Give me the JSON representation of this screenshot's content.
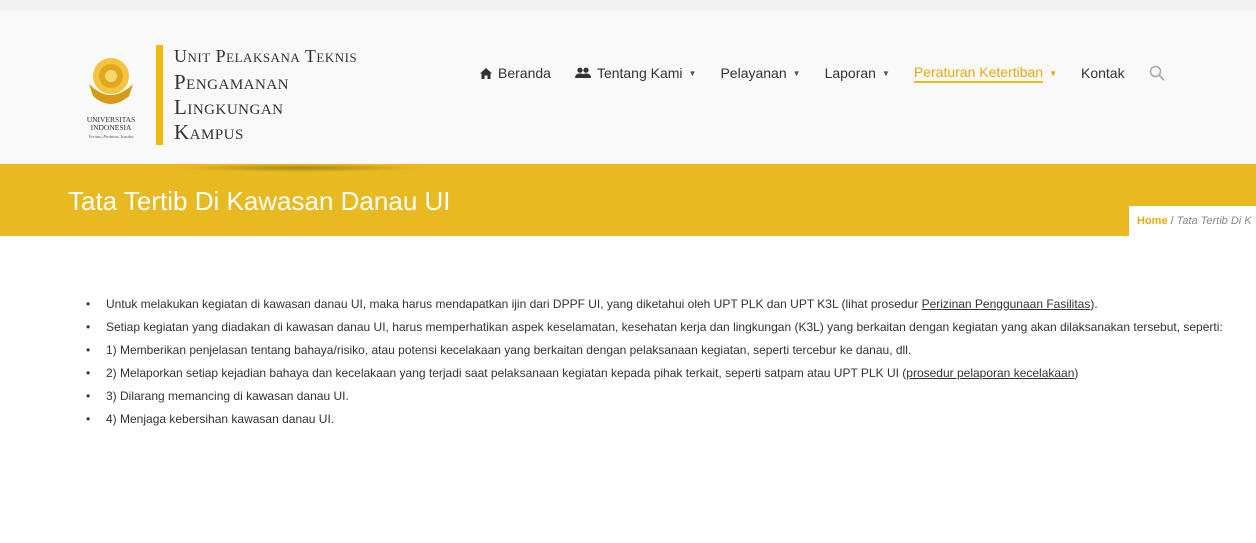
{
  "brand": {
    "lines": [
      "Unit Pelaksana Teknis",
      "Pengamanan",
      "Lingkungan",
      "Kampus"
    ],
    "logo_text": [
      "UNIVERSITAS",
      "INDONESIA",
      "Veritas, Probitas, Iustitia"
    ]
  },
  "nav": {
    "items": [
      {
        "label": "Beranda",
        "icon": "home-icon",
        "dropdown": false
      },
      {
        "label": "Tentang Kami",
        "icon": "users-icon",
        "dropdown": true
      },
      {
        "label": "Pelayanan",
        "dropdown": true
      },
      {
        "label": "Laporan",
        "dropdown": true
      },
      {
        "label": "Peraturan Ketertiban",
        "dropdown": true,
        "active": true
      },
      {
        "label": "Kontak",
        "dropdown": false
      }
    ],
    "search_icon": "search-icon"
  },
  "page": {
    "title": "Tata Tertib Di Kawasan Danau UI",
    "breadcrumb": {
      "home": "Home",
      "separator": "/",
      "current": "Tata Tertib Di K"
    }
  },
  "content": {
    "item1": {
      "text": "Untuk melakukan kegiatan di kawasan danau UI, maka harus mendapatkan ijin dari DPPF UI, yang diketahui oleh UPT PLK dan UPT K3L (lihat prosedur ",
      "link": "Perizinan Penggunaan Fasilitas",
      "after": ")."
    },
    "item2": "Setiap kegiatan yang diadakan di kawasan danau UI, harus memperhatikan aspek keselamatan, kesehatan kerja dan lingkungan (K3L) yang berkaitan dengan kegiatan yang akan dilaksanakan tersebut, seperti:",
    "item3": "1) Memberikan penjelasan tentang bahaya/risiko, atau potensi kecelakaan yang berkaitan dengan pelaksanaan kegiatan, seperti tercebur ke danau, dll.",
    "item4": {
      "text": "2) Melaporkan setiap kejadian bahaya dan kecelakaan yang terjadi saat pelaksanaan kegiatan kepada pihak terkait, seperti satpam atau UPT PLK UI (",
      "link": "prosedur pelaporan kecelakaan",
      "after": ")"
    },
    "item5": "3) Dilarang memancing di kawasan danau UI.",
    "item6": "4) Menjaga kebersihan kawasan danau UI."
  },
  "colors": {
    "accent": "#e9b921",
    "active_nav": "#e6a90f"
  }
}
